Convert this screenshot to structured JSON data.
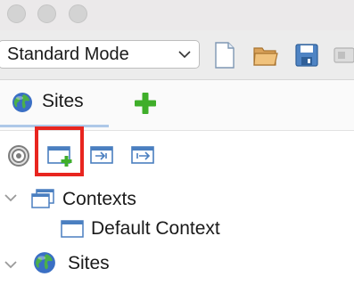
{
  "toolbar": {
    "mode_value": "Standard Mode"
  },
  "tabs": {
    "sites_label": "Sites"
  },
  "tree": {
    "contexts_label": "Contexts",
    "default_context_label": "Default Context",
    "sites_label": "Sites"
  },
  "icons": {
    "traffic": [
      "traffic-light",
      "traffic-light",
      "traffic-light"
    ],
    "toolbar": [
      "dropdown-chevron",
      "new-session-icon",
      "open-session-icon",
      "save-session-icon",
      "properties-icon"
    ],
    "tab": [
      "globe-icon",
      "plus-icon"
    ],
    "subtoolbar": [
      "target-icon",
      "new-context-icon",
      "import-context-icon",
      "export-context-icon"
    ],
    "tree": [
      "chevron-down-icon",
      "context-folder-icon",
      "context-window-icon",
      "chevron-down-icon",
      "globe-icon"
    ]
  },
  "colors": {
    "highlight": "#e8251f",
    "tab_underline": "#aec8e8",
    "plus_green": "#3fae2a"
  }
}
